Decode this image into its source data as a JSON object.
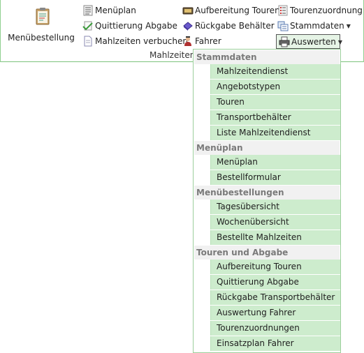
{
  "ribbon": {
    "big_button": {
      "label": "Menübestellung",
      "icon": "clipboard-order-icon"
    },
    "col1": [
      {
        "label": "Menüplan",
        "icon": "menu-list-icon"
      },
      {
        "label": "Quittierung Abgabe",
        "icon": "checkmark-document-icon"
      },
      {
        "label": "Mahlzeiten verbuchen",
        "icon": "document-icon"
      }
    ],
    "col2": [
      {
        "label": "Aufbereitung Touren",
        "icon": "tray-icon"
      },
      {
        "label": "Rückgabe Behälter",
        "icon": "return-container-icon"
      },
      {
        "label": "Fahrer",
        "icon": "driver-person-icon"
      }
    ],
    "col3": [
      {
        "label": "Tourenzuordnung",
        "icon": "list-assign-icon"
      },
      {
        "label": "Stammdaten",
        "icon": "master-data-icon"
      },
      {
        "label": "Auswerten",
        "icon": "printer-icon"
      }
    ],
    "group_label": "Mahlzeitend"
  },
  "menu": {
    "sections": [
      {
        "header": "Stammdaten",
        "items": [
          "Mahlzeitendienst",
          "Angebotstypen",
          "Touren",
          "Transportbehälter",
          "Liste Mahlzeitendienst"
        ]
      },
      {
        "header": "Menüplan",
        "items": [
          "Menüplan",
          "Bestellformular"
        ]
      },
      {
        "header": "Menübestellungen",
        "items": [
          "Tagesübersicht",
          "Wochenübersicht",
          "Bestellte Mahlzeiten"
        ]
      },
      {
        "header": "Touren und Abgabe",
        "items": [
          "Aufbereitung Touren",
          "Quittierung Abgabe",
          "Rückgabe Transportbehälter",
          "Auswertung Fahrer",
          "Tourenzuordnungen",
          "Einsatzplan Fahrer"
        ]
      }
    ]
  },
  "colors": {
    "accent": "#7cc27c",
    "item_bg": "#cdeccd",
    "header_bg": "#f1f1f1"
  }
}
